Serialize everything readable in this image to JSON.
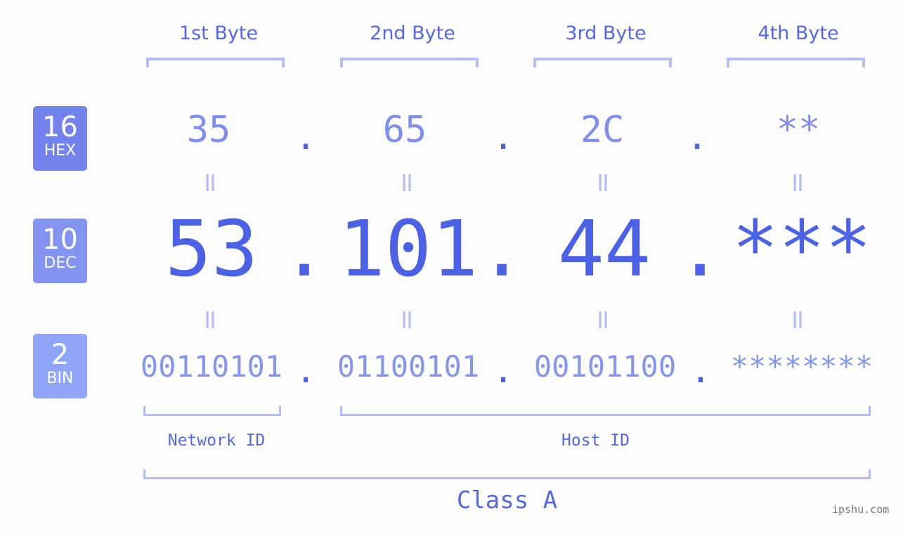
{
  "badges": [
    {
      "num": "16",
      "label": "HEX",
      "color": "#7383ee"
    },
    {
      "num": "10",
      "label": "DEC",
      "color": "#8293f1"
    },
    {
      "num": "2",
      "label": "BIN",
      "color": "#8fa5f7"
    }
  ],
  "bytes": [
    {
      "label": "1st Byte",
      "hex": "35",
      "dec": "53",
      "bin": "00110101"
    },
    {
      "label": "2nd Byte",
      "hex": "65",
      "dec": "101",
      "bin": "01100101"
    },
    {
      "label": "3rd Byte",
      "hex": "2C",
      "dec": "44",
      "bin": "00101100"
    },
    {
      "label": "4th Byte",
      "hex": "**",
      "dec": "***",
      "bin": "********"
    }
  ],
  "separator": ".",
  "equals": "=",
  "network_id_label": "Network ID",
  "host_id_label": "Host ID",
  "class_label": "Class A",
  "watermark": "ipshu.com",
  "colors": {
    "accent": "#4c62e6",
    "label": "#5468e4",
    "bracket": "#b3bcf6",
    "hex_text": "#7f8fee",
    "bin_text": "#8596ef"
  }
}
